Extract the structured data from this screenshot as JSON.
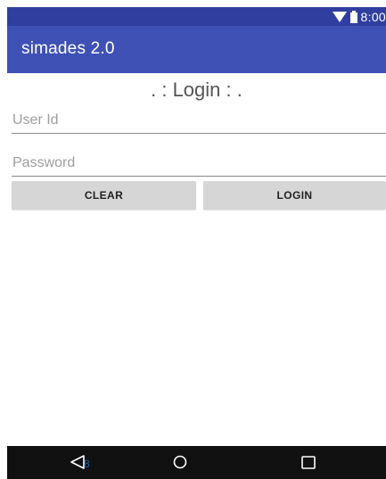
{
  "status_bar": {
    "time": "8:00",
    "icons": [
      "wifi-icon",
      "battery-icon"
    ]
  },
  "app_bar": {
    "title": "simades 2.0"
  },
  "login": {
    "heading": ". : Login : .",
    "userid_placeholder": "User Id",
    "password_placeholder": "Password",
    "clear_label": "CLEAR",
    "login_label": "LOGIN"
  },
  "nav_bar": {
    "icons": [
      "back-icon",
      "home-icon",
      "recents-icon"
    ],
    "badge": "8"
  },
  "colors": {
    "status_bar": "#303f9f",
    "app_bar": "#3f51b5",
    "button": "#d6d6d6",
    "nav_bar": "#111111"
  }
}
